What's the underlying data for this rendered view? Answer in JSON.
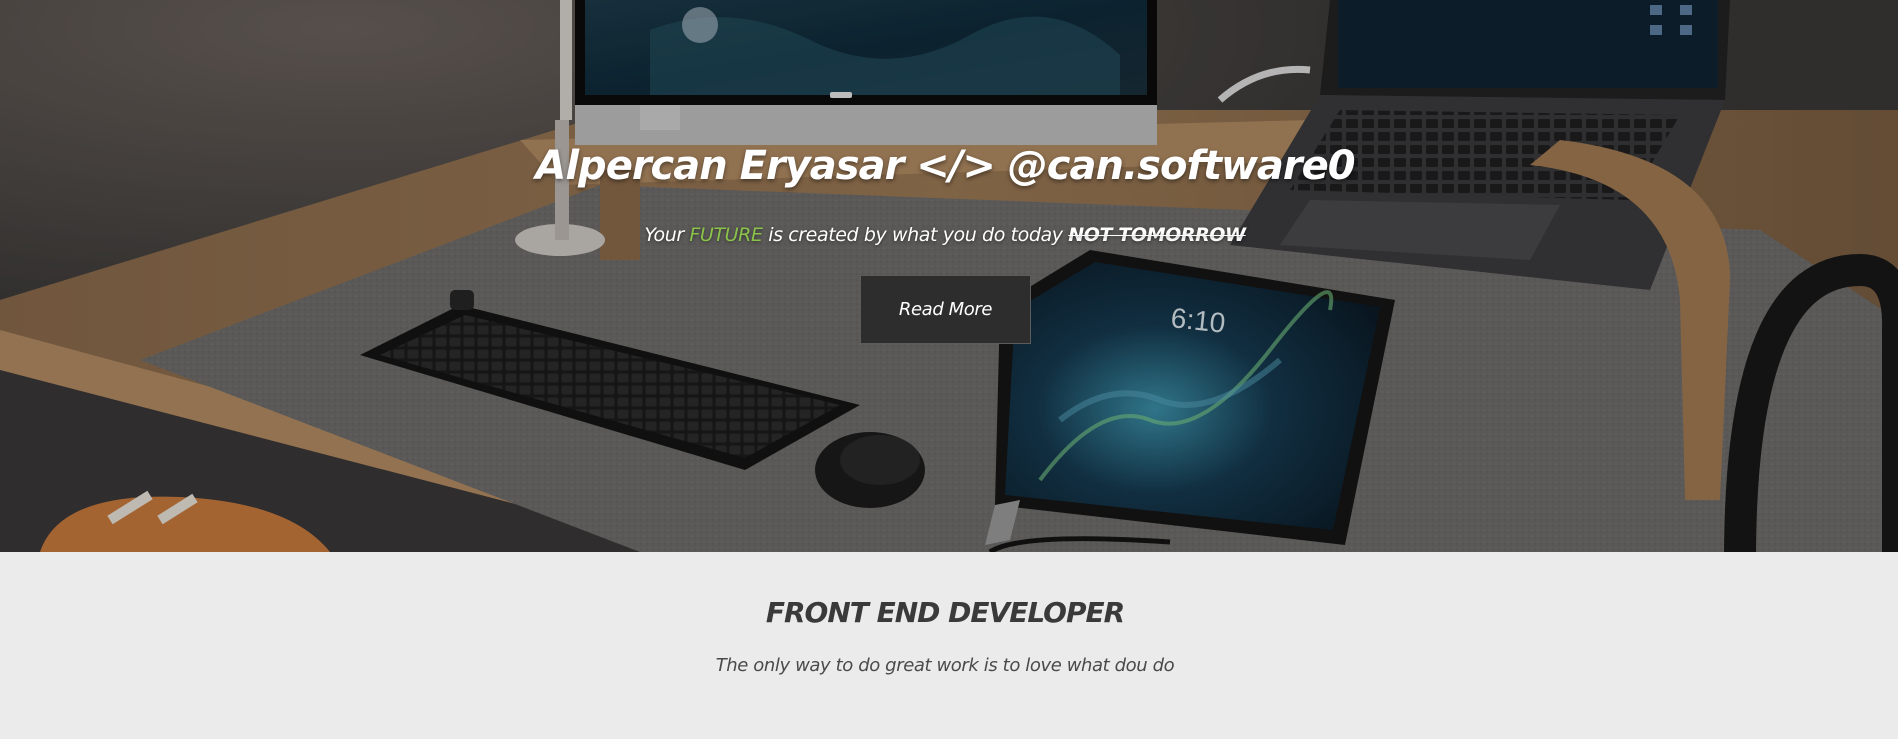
{
  "hero": {
    "title": "Alpercan Eryasar </> @can.software0",
    "tagline_before": "Your ",
    "tagline_accent": "FUTURE",
    "tagline_middle": " is created by what you do today ",
    "tagline_emphasis": "NOT TOMORROW",
    "cta_label": "Read More",
    "accent_color": "#8bc34a"
  },
  "tablet_time": "6:10",
  "about": {
    "heading": "FRONT END DEVELOPER",
    "quote": "The only way to do great work is to love what dou do"
  }
}
